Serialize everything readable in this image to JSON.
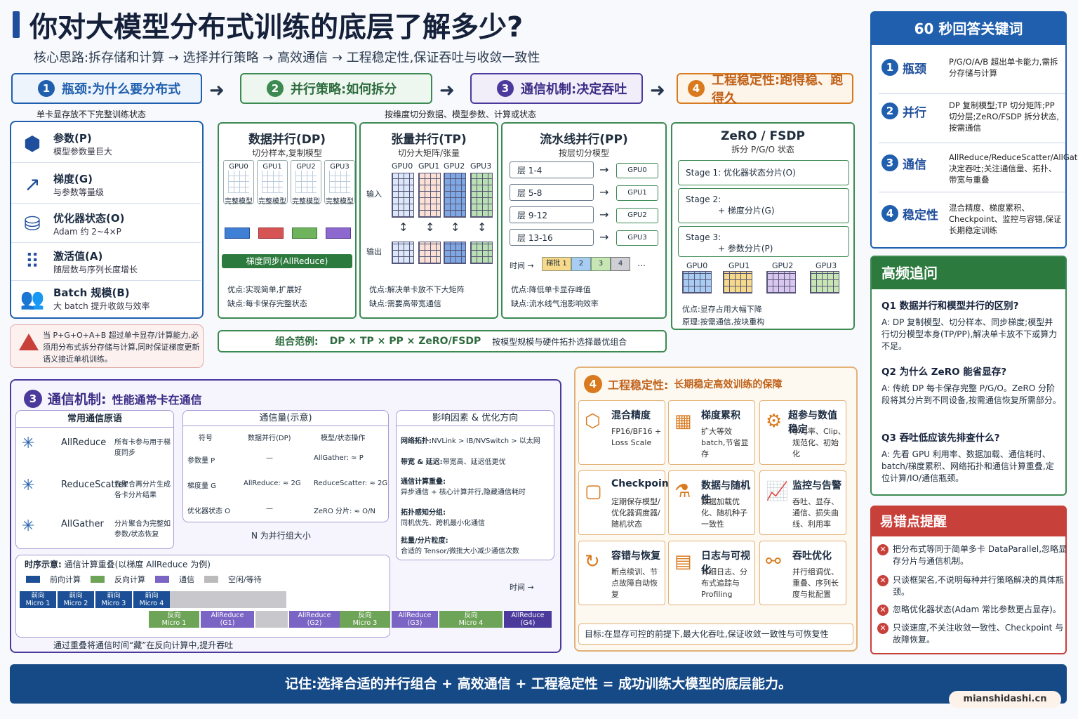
{
  "header": {
    "title": "你对大模型分布式训练的底层了解多少?",
    "subtitle": "核心思路:拆存储和计算 → 选择并行策略 → 高效通信 → 工程稳定性,保证吞吐与收敛一致性"
  },
  "stages": [
    {
      "num": "1",
      "label": "瓶颈:为什么要分布式",
      "color": "#1f5fae"
    },
    {
      "num": "2",
      "label": "并行策略:如何拆分",
      "color": "#3c8a52"
    },
    {
      "num": "3",
      "label": "通信机制:决定吞吐",
      "color": "#4b3a9c"
    },
    {
      "num": "4",
      "label": "工程稳定性:跑得稳、跑得久",
      "color": "#d97a1e"
    }
  ],
  "arrows": {
    "a": "➜"
  },
  "bottleneck": {
    "caption": "单卡显存放不下完整训练状态",
    "items": [
      {
        "icon": "⬢",
        "title": "参数(P)",
        "desc": "模型参数量巨大"
      },
      {
        "icon": "↗",
        "title": "梯度(G)",
        "desc": "与参数等量级"
      },
      {
        "icon": "⛁",
        "title": "优化器状态(O)",
        "desc": "Adam 约 2~4×P"
      },
      {
        "icon": "⠿",
        "title": "激活值(A)",
        "desc": "随层数与序列长度增长"
      },
      {
        "icon": "👥",
        "title": "Batch 规模(B)",
        "desc": "大 batch 提升收敛与效率"
      }
    ],
    "warn": "当 P+G+O+A+B 超过单卡显存/计算能力,必须用分布式拆分存储与计算,同时保证梯度更新语义接近单机训练。"
  },
  "strategy_caption": "按维度切分数据、模型参数、计算或状态",
  "dp": {
    "title": "数据并行(DP)",
    "sub": "切分样本,复制模型",
    "gpus": [
      "GPU0",
      "GPU1",
      "GPU2",
      "GPU3"
    ],
    "model_label": "完整模型",
    "sync": "梯度同步(AllReduce)",
    "pros": "优点:实现简单,扩展好",
    "cons": "缺点:每卡保存完整状态"
  },
  "tp": {
    "title": "张量并行(TP)",
    "sub": "切分大矩阵/张量",
    "gpus": [
      "GPU0",
      "GPU1",
      "GPU2",
      "GPU3"
    ],
    "in": "输入",
    "out": "输出",
    "pros": "优点:解决单卡放不下大矩阵",
    "cons": "缺点:需要高带宽通信"
  },
  "pp": {
    "title": "流水线并行(PP)",
    "sub": "按层切分模型",
    "layers": [
      "层 1-4",
      "层 5-8",
      "层 9-12",
      "层 13-16"
    ],
    "gpus": [
      "GPU0",
      "GPU1",
      "GPU2",
      "GPU3"
    ],
    "time": "时间 →",
    "batches": [
      "梯批 1",
      "2",
      "3",
      "4",
      "…"
    ],
    "pros": "优点:降低单卡显存峰值",
    "cons": "缺点:流水线气泡影响效率"
  },
  "zero": {
    "title": "ZeRO / FSDP",
    "sub": "拆分 P/G/O 状态",
    "stages": [
      {
        "a": "Stage 1:",
        "b": "优化器状态分片(O)"
      },
      {
        "a": "Stage 2:",
        "b": "+ 梯度分片(G)"
      },
      {
        "a": "Stage 3:",
        "b": "+ 参数分片(P)"
      }
    ],
    "gpus": [
      "GPU0",
      "GPU1",
      "GPU2",
      "GPU3"
    ],
    "pros": "优点:显存占用大幅下降",
    "rule": "原理:按需通信,按块重构"
  },
  "combo": {
    "label": "组合范例:",
    "formula": "DP × TP × PP × ZeRO/FSDP",
    "note": "按模型规模与硬件拓扑选择最优组合"
  },
  "comm": {
    "title": "通信机制:",
    "title2": "性能通常卡在通信",
    "prims_title": "常用通信原语",
    "prims": [
      {
        "name": "AllReduce",
        "desc": "所有卡参与用于梯度同步"
      },
      {
        "name": "ReduceScatter",
        "desc": "先聚合再分片生成各卡分片结果"
      },
      {
        "name": "AllGather",
        "desc": "分片聚合为完整如参数/状态恢复"
      }
    ],
    "vol_title": "通信量(示意)",
    "vol_head": [
      "符号",
      "数据并行(DP)",
      "模型/状态操作"
    ],
    "vol_rows": [
      [
        "参数量 P",
        "—",
        "AllGather: ≈ P"
      ],
      [
        "梯度量 G",
        "AllReduce: ≈ 2G",
        "ReduceScatter: ≈ 2G"
      ],
      [
        "优化器状态 O",
        "—",
        "ZeRO 分片: ≈ O/N"
      ]
    ],
    "vol_note": "N 为并行组大小",
    "factors_title": "影响因素 & 优化方向",
    "factors": [
      {
        "t": "网络拓扑:",
        "d": "NVLink > IB/NVSwitch > 以太网"
      },
      {
        "t": "带宽 & 延迟:",
        "d": "带宽高、延迟低更优"
      },
      {
        "t": "通信计算重叠:",
        "d": "异步通信 + 核心计算并行,隐藏通信耗时"
      },
      {
        "t": "拓扑感知分组:",
        "d": "同机优先、跨机最小化通信"
      },
      {
        "t": "批量/分片粒度:",
        "d": "合适的 Tensor/微批大小减少通信次数"
      }
    ],
    "timeline_title": "时序示意:",
    "timeline_sub": "通信计算重叠(以梯度 AllReduce 为例)",
    "legend": [
      "前向计算",
      "反向计算",
      "通信",
      "空闲/等待"
    ],
    "time": "时间 →",
    "fw": [
      "前向\nMicro 1",
      "前向\nMicro 2",
      "前向\nMicro 3",
      "前向\nMicro 4"
    ],
    "bw": [
      "反向\nMicro 1",
      "AllReduce\n(G1)",
      "AllReduce\n(G2)",
      "反向\nMicro 3",
      "AllReduce\n(G3)",
      "反向\nMicro 4",
      "AllReduce\n(G4)"
    ],
    "note": "通过重叠将通信时间“藏”在反向计算中,提升吞吐"
  },
  "eng": {
    "num": "4",
    "title": "工程稳定性:",
    "title2": "长期稳定高效训练的保障",
    "cells": [
      {
        "icon": "⬡",
        "t": "混合精度",
        "d": "FP16/BF16 + Loss Scale"
      },
      {
        "icon": "▦",
        "t": "梯度累积",
        "d": "扩大等效 batch,节省显存"
      },
      {
        "icon": "⚙",
        "t": "超参与数值稳定",
        "d": "学习率、Clip、规范化、初始化"
      },
      {
        "icon": "▢",
        "t": "Checkpoint",
        "d": "定期保存模型/优化器调度器/随机状态"
      },
      {
        "icon": "⚗",
        "t": "数据与随机性",
        "d": "数据加载优化、随机种子一致性"
      },
      {
        "icon": "📈",
        "t": "监控与告警",
        "d": "吞吐、显存、通信、损失曲线、利用率"
      },
      {
        "icon": "↻",
        "t": "容错与恢复",
        "d": "断点续训、节点故障自动恢复"
      },
      {
        "icon": "▤",
        "t": "日志与可视化",
        "d": "详细日志、分布式追踪与 Profiling"
      },
      {
        "icon": "⚯",
        "t": "吞吐优化",
        "d": "并行组调优、重叠、序列长度与批配置"
      }
    ],
    "goal": "目标:在显存可控的前提下,最大化吞吐,保证收敛一致性与可恢复性"
  },
  "keywords": {
    "title": "60 秒回答关键词",
    "items": [
      {
        "n": "1",
        "k": "瓶颈",
        "d": "P/G/O/A/B 超出单卡能力,需拆分存储与计算"
      },
      {
        "n": "2",
        "k": "并行",
        "d": "DP 复制模型;TP 切分矩阵;PP 切分层;ZeRO/FSDP 拆分状态,按需通信"
      },
      {
        "n": "3",
        "k": "通信",
        "d": "AllReduce/ReduceScatter/AllGather 决定吞吐;关注通信量、拓扑、带宽与重叠"
      },
      {
        "n": "4",
        "k": "稳定性",
        "d": "混合精度、梯度累积、Checkpoint、监控与容错,保证长期稳定训练"
      }
    ]
  },
  "faq": {
    "title": "高频追问",
    "items": [
      {
        "q": "Q1 数据并行和模型并行的区别?",
        "a": "A: DP 复制模型、切分样本、同步梯度;模型并行切分模型本身(TP/PP),解决单卡放不下或算力不足。"
      },
      {
        "q": "Q2 为什么 ZeRO 能省显存?",
        "a": "A: 传统 DP 每卡保存完整 P/G/O。ZeRO 分阶段将其分片到不同设备,按需通信恢复所需部分。"
      },
      {
        "q": "Q3 吞吐低应该先排查什么?",
        "a": "A: 先看 GPU 利用率、数据加载、通信耗时、batch/梯度累积、网络拓扑和通信计算重叠,定位计算/IO/通信瓶颈。"
      }
    ]
  },
  "mistakes": {
    "title": "易错点提醒",
    "items": [
      "把分布式等同于简单多卡 DataParallel,忽略显存分片与通信机制。",
      "只谈框架名,不说明每种并行策略解决的具体瓶颈。",
      "忽略优化器状态(Adam 常比参数更占显存)。",
      "只谈速度,不关注收敛一致性、Checkpoint 与故障恢复。"
    ]
  },
  "footer": {
    "text": "记住:选择合适的并行组合 + 高效通信 + 工程稳定性 = 成功训练大模型的底层能力。",
    "watermark": "mianshidashi.cn"
  }
}
